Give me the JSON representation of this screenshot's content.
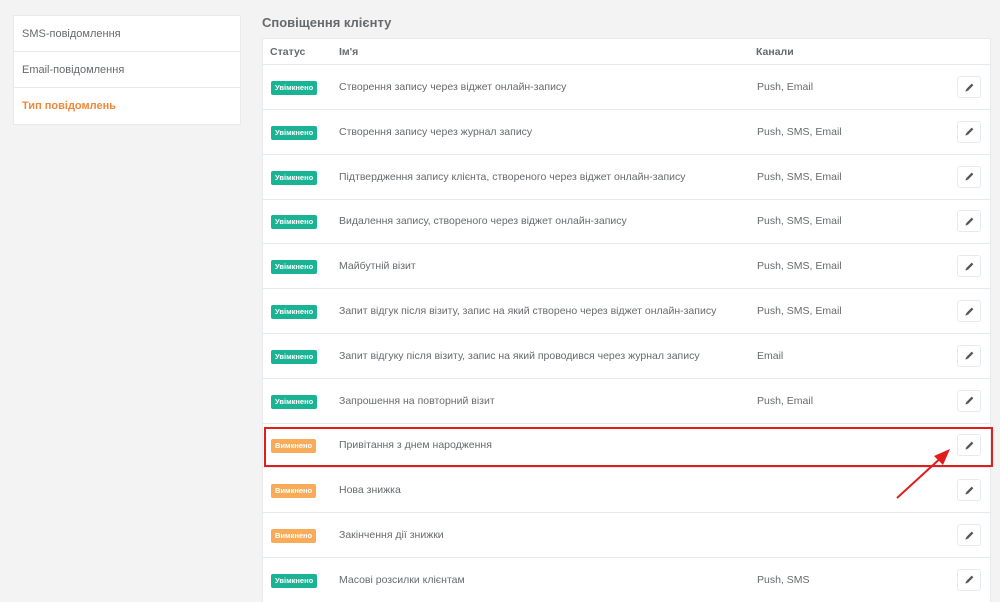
{
  "sidebar": {
    "items": [
      {
        "label": "SMS-повідомлення"
      },
      {
        "label": "Email-повідомлення"
      },
      {
        "label": "Тип повідомлень"
      }
    ]
  },
  "section_title": "Сповіщення клієнту",
  "table": {
    "headers": {
      "status": "Статус",
      "name": "Ім'я",
      "channels": "Канали"
    },
    "rows": [
      {
        "status": "Увімкнено",
        "state": "on",
        "name": "Створення запису через віджет онлайн-запису",
        "channels": "Push, Email"
      },
      {
        "status": "Увімкнено",
        "state": "on",
        "name": "Створення запису через журнал запису",
        "channels": "Push, SMS, Email"
      },
      {
        "status": "Увімкнено",
        "state": "on",
        "name": "Підтвердження запису клієнта, створеного через віджет онлайн-запису",
        "channels": "Push, SMS, Email"
      },
      {
        "status": "Увімкнено",
        "state": "on",
        "name": "Видалення запису, створеного через віджет онлайн-запису",
        "channels": "Push, SMS, Email"
      },
      {
        "status": "Увімкнено",
        "state": "on",
        "name": "Майбутній візит",
        "channels": "Push, SMS, Email"
      },
      {
        "status": "Увімкнено",
        "state": "on",
        "name": "Запит відгук після візиту, запис на який створено через віджет онлайн-запису",
        "channels": "Push, SMS, Email"
      },
      {
        "status": "Увімкнено",
        "state": "on",
        "name": "Запит відгуку після візиту, запис на який проводився через журнал запису",
        "channels": "Email"
      },
      {
        "status": "Увімкнено",
        "state": "on",
        "name": "Запрошення на повторний візит",
        "channels": "Push, Email"
      },
      {
        "status": "Вимкнено",
        "state": "off",
        "name": "Привітання з днем народження",
        "channels": ""
      },
      {
        "status": "Вимкнено",
        "state": "off",
        "name": "Нова знижка",
        "channels": ""
      },
      {
        "status": "Вимкнено",
        "state": "off",
        "name": "Закінчення дії знижки",
        "channels": ""
      },
      {
        "status": "Увімкнено",
        "state": "on",
        "name": "Масові розсилки клієнтам",
        "channels": "Push, SMS"
      }
    ]
  },
  "colors": {
    "enabled": "#1ab394",
    "disabled": "#f8ac59",
    "active_sidebar": "#f0883a",
    "highlight": "#e21d1d"
  },
  "icons": {
    "edit": "pencil-icon"
  }
}
